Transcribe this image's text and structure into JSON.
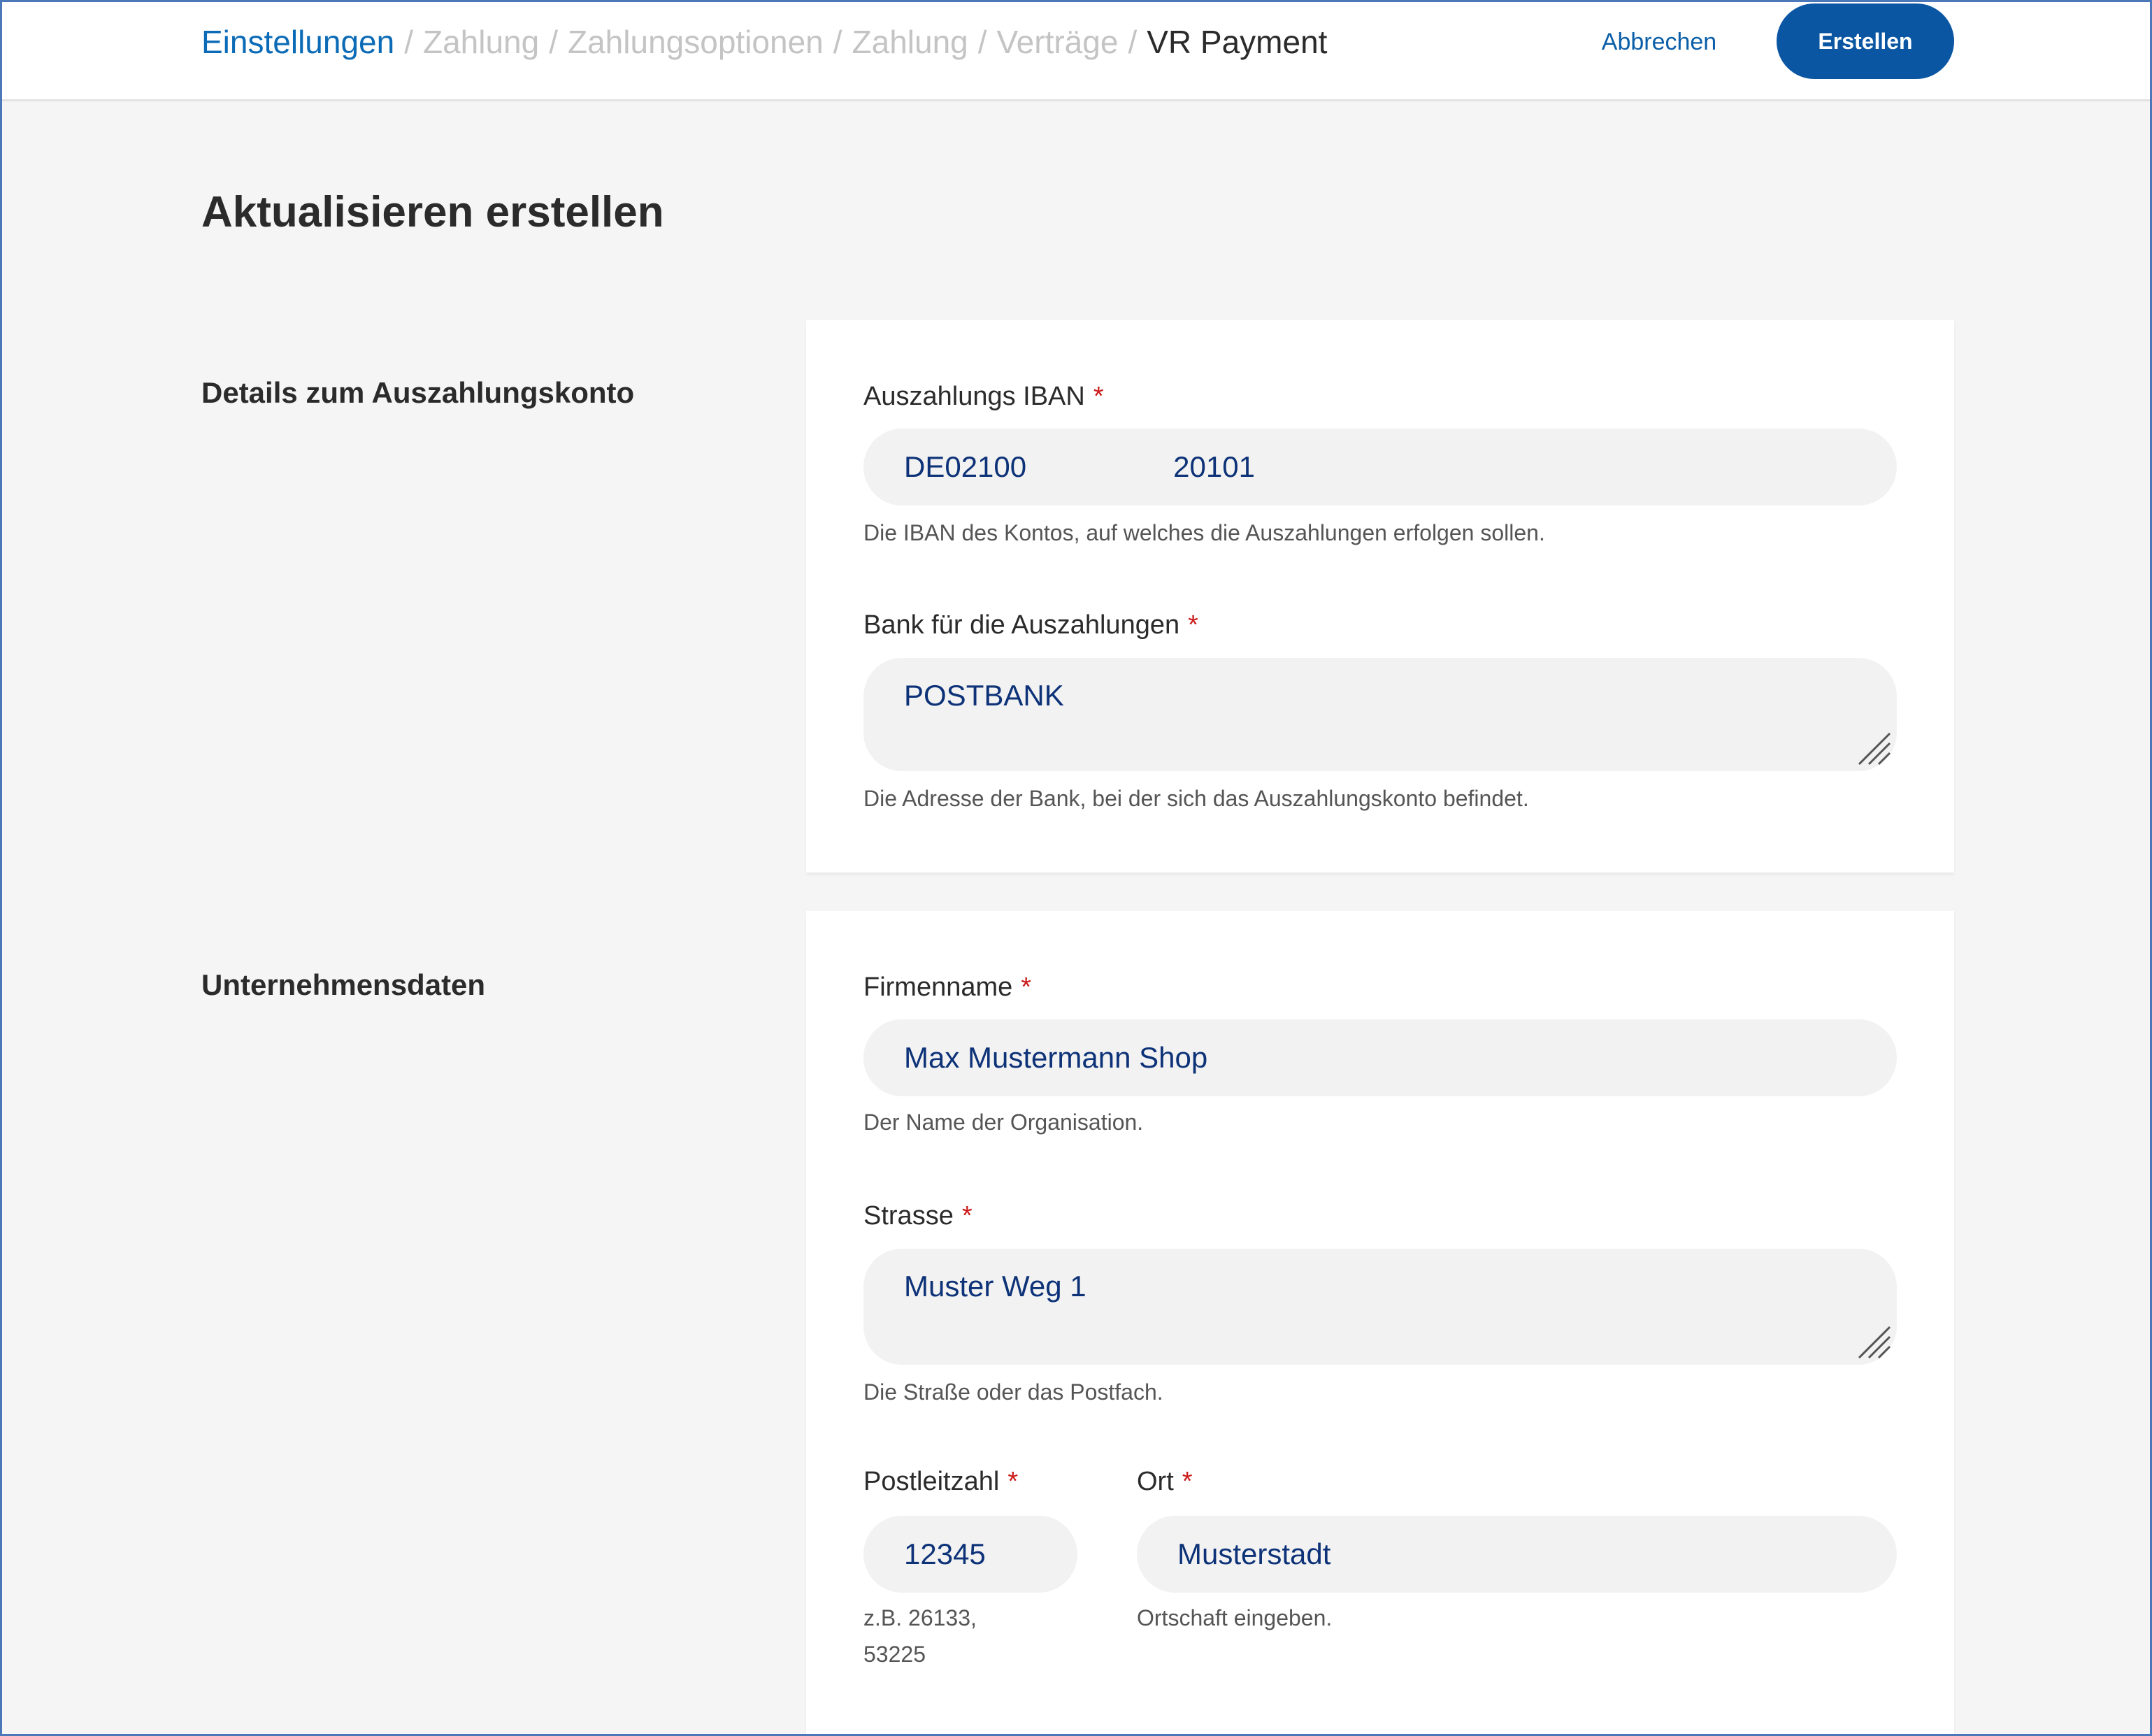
{
  "breadcrumb": {
    "items": [
      "Einstellungen",
      "Zahlung",
      "Zahlungsoptionen",
      "Zahlung",
      "Verträge",
      "VR Payment"
    ],
    "separator": "/"
  },
  "actions": {
    "cancel_label": "Abbrechen",
    "create_label": "Erstellen"
  },
  "page": {
    "title": "Aktualisieren erstellen"
  },
  "sections": {
    "payout": {
      "label": "Details zum Auszahlungskonto",
      "iban": {
        "label": "Auszahlungs IBAN",
        "required_mark": "*",
        "value": "DE02100                  20101",
        "help": "Die IBAN des Kontos, auf welches die Auszahlungen erfolgen sollen."
      },
      "bank": {
        "label": "Bank für die Auszahlungen",
        "required_mark": "*",
        "value": "POSTBANK",
        "help": "Die Adresse der Bank, bei der sich das Auszahlungskonto befindet."
      }
    },
    "company": {
      "label": "Unternehmensdaten",
      "name": {
        "label": "Firmenname",
        "required_mark": "*",
        "value": "Max Mustermann Shop",
        "help": "Der Name der Organisation."
      },
      "street": {
        "label": "Strasse",
        "required_mark": "*",
        "value": "Muster Weg 1",
        "help": "Die Straße oder das Postfach."
      },
      "zip": {
        "label": "Postleitzahl",
        "required_mark": "*",
        "value": "12345",
        "help_line1": "z.B. 26133,",
        "help_line2": "53225"
      },
      "city": {
        "label": "Ort",
        "required_mark": "*",
        "value": "Musterstadt",
        "help": "Ortschaft eingeben."
      }
    }
  },
  "colors": {
    "primary": "#0a56a3",
    "link": "#0b6bb6",
    "input_text": "#0d3278",
    "required": "#cc1a1a",
    "background": "#f5f5f5"
  }
}
